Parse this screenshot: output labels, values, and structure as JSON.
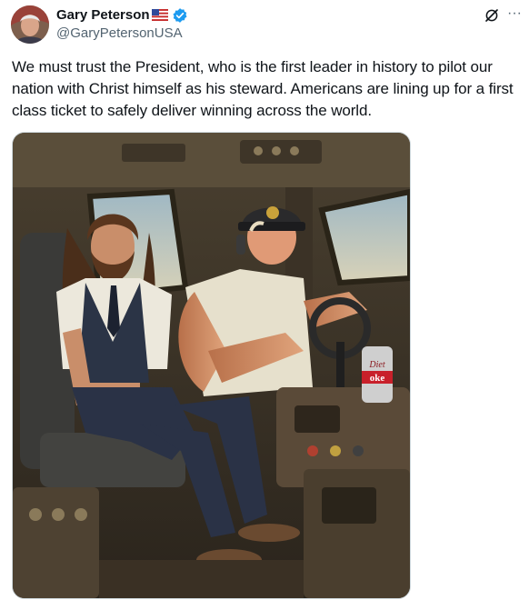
{
  "author": {
    "display_name": "Gary Peterson",
    "handle": "@GaryPetersonUSA",
    "flag_icon": "us-flag-icon",
    "verified_icon": "verified-badge-icon",
    "verified_color": "#1d9bf0"
  },
  "actions": {
    "grok_icon": "grok-icon",
    "more_label": "···"
  },
  "post": {
    "text": "We must trust the President, who is the first leader in history to pilot our nation with Christ himself as his steward.  Americans are lining up for a first class ticket to safely deliver winning across the world."
  },
  "media": {
    "can_text_top": "Diet",
    "can_text_bottom": "oke"
  }
}
